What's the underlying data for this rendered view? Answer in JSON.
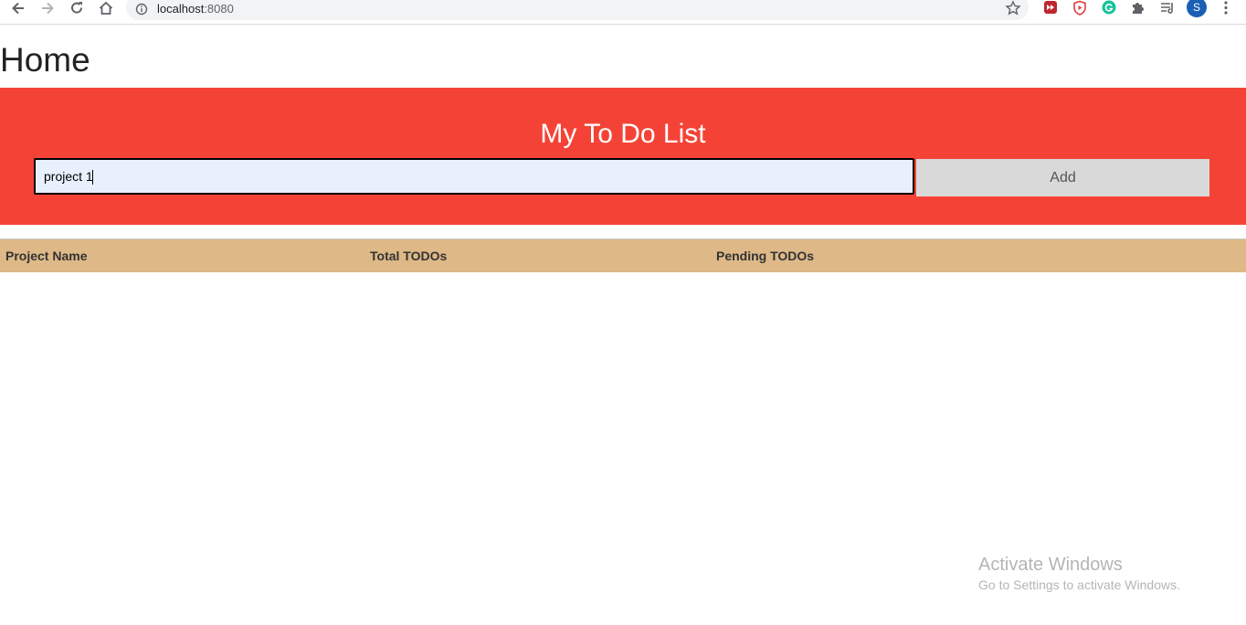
{
  "browser": {
    "url_host": "localhost",
    "url_port": ":8080",
    "profile_initial": "S"
  },
  "page": {
    "title": "Home"
  },
  "todo": {
    "heading": "My To Do List",
    "input_value": "project 1",
    "add_label": "Add"
  },
  "table": {
    "columns": [
      "Project Name",
      "Total TODOs",
      "Pending TODOs"
    ]
  },
  "watermark": {
    "title": "Activate Windows",
    "subtitle": "Go to Settings to activate Windows."
  },
  "colors": {
    "header_red": "#f44336",
    "table_header_tan": "#deb887",
    "add_button_grey": "#d9d9d9",
    "input_bg": "#e8f0fe"
  }
}
